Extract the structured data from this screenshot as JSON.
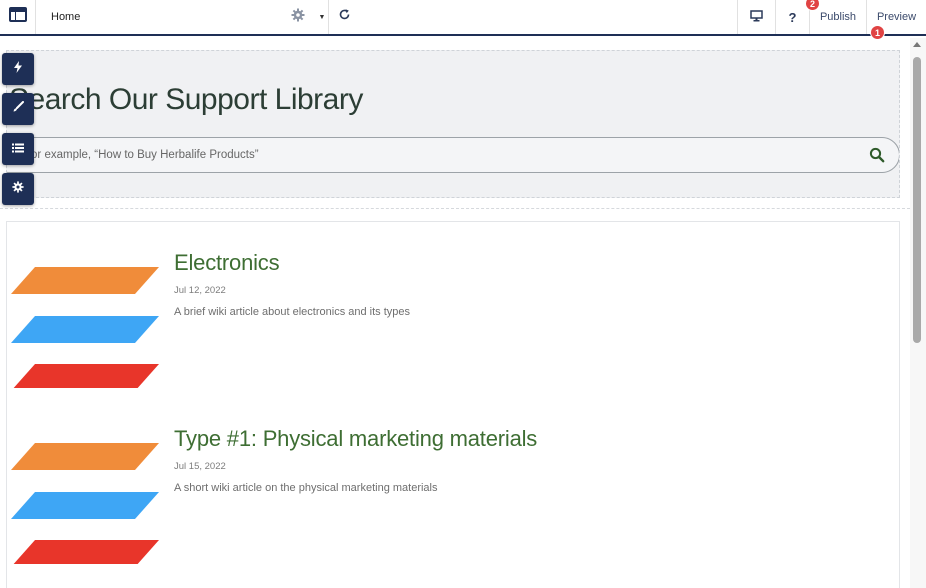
{
  "toolbar": {
    "page_name": "Home",
    "publish_label": "Publish",
    "preview_label": "Preview",
    "help_label": "?",
    "publish_badge": "2",
    "preview_badge": "1"
  },
  "icons": {
    "logo": "layout-panels-icon",
    "settings": "gear-icon",
    "dropdown": "caret-down-icon",
    "refresh": "refresh-icon",
    "device": "desktop-monitor-icon",
    "tool_1": "lightning-bolt-icon",
    "tool_2": "paint-brush-icon",
    "tool_3": "list-icon",
    "tool_4": "settings-gear-icon",
    "search": "magnifier-icon"
  },
  "colors": {
    "toolbar_accent": "#1e2f56",
    "badge": "#e04343",
    "article_title": "#3e6e33",
    "stripe_orange": "#f08c3a",
    "stripe_blue": "#3ea6f5",
    "stripe_red": "#e8352a"
  },
  "search": {
    "title": "Search Our Support Library",
    "placeholder": "For example, “How to Buy Herbalife Products”"
  },
  "articles": [
    {
      "title": "Electronics",
      "date": "Jul 12, 2022",
      "description": "A brief wiki article about electronics and its types"
    },
    {
      "title": "Type #1: Physical marketing materials",
      "date": "Jul 15, 2022",
      "description": "A short wiki article on the physical marketing materials"
    }
  ]
}
